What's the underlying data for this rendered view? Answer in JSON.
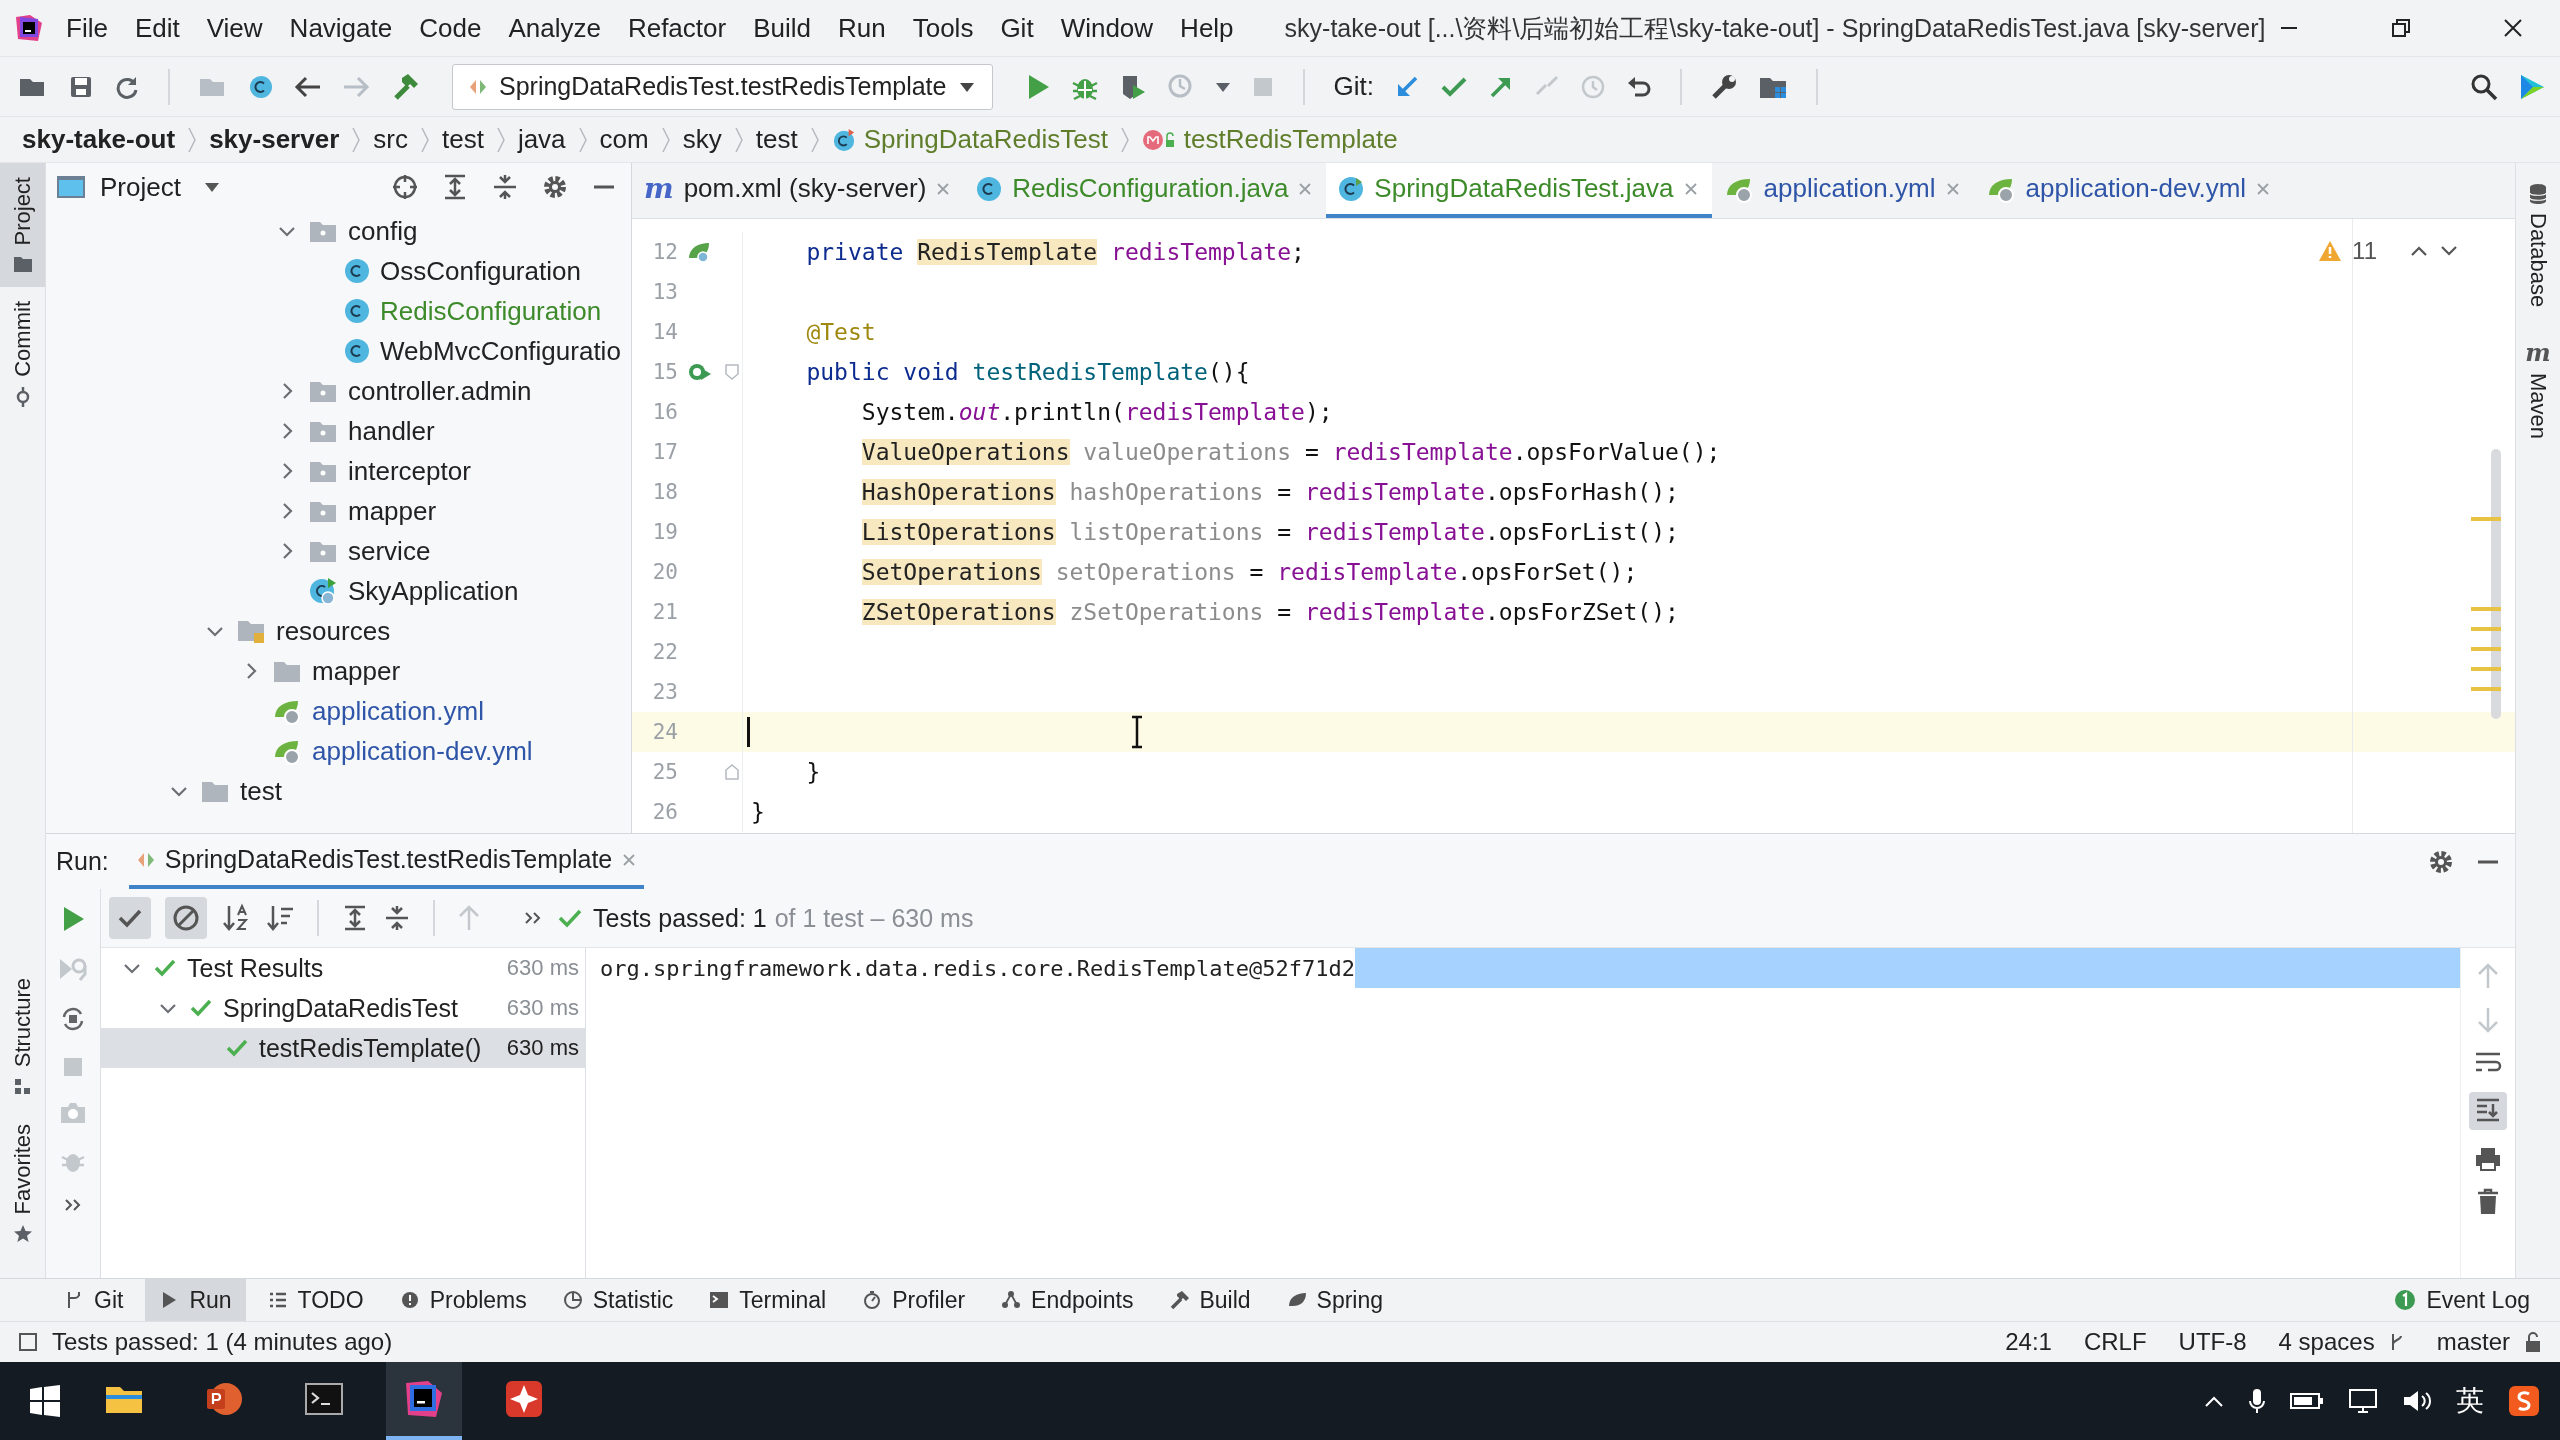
{
  "window": {
    "title": "sky-take-out [...\\资料\\后端初始工程\\sky-take-out] - SpringDataRedisTest.java [sky-server]",
    "menu": [
      "File",
      "Edit",
      "View",
      "Navigate",
      "Code",
      "Analyze",
      "Refactor",
      "Build",
      "Run",
      "Tools",
      "Git",
      "Window",
      "Help"
    ]
  },
  "toolbar": {
    "run_config": "SpringDataRedisTest.testRedisTemplate",
    "git_label": "Git:"
  },
  "breadcrumbs": [
    {
      "label": "sky-take-out",
      "kind": "module"
    },
    {
      "label": "sky-server",
      "kind": "module"
    },
    {
      "label": "src",
      "kind": "dir"
    },
    {
      "label": "test",
      "kind": "dir"
    },
    {
      "label": "java",
      "kind": "dir"
    },
    {
      "label": "com",
      "kind": "dir"
    },
    {
      "label": "sky",
      "kind": "dir"
    },
    {
      "label": "test",
      "kind": "dir"
    },
    {
      "label": "SpringDataRedisTest",
      "kind": "class"
    },
    {
      "label": "testRedisTemplate",
      "kind": "method"
    }
  ],
  "left_stripe": {
    "top": [
      {
        "label": "Project",
        "kind": "project",
        "selected": true
      },
      {
        "label": "Commit",
        "kind": "commit",
        "selected": false
      }
    ],
    "bottom": [
      {
        "label": "Structure",
        "kind": "structure",
        "selected": false
      },
      {
        "label": "Favorites",
        "kind": "favorites",
        "selected": false
      }
    ]
  },
  "right_stripe": [
    {
      "label": "Database",
      "kind": "database"
    },
    {
      "label": "Maven",
      "kind": "maven",
      "icon": "m"
    }
  ],
  "project_panel": {
    "title": "Project",
    "tree": [
      {
        "children": [
          {
            "children": [
              {
                "children": [
                  {
                    "children": [
                      {
                        "label": "config",
                        "kind": "package",
                        "expanded": true,
                        "children": [
                          {
                            "label": "OssConfiguration",
                            "kind": "class",
                            "color": "#222222"
                          },
                          {
                            "label": "RedisConfiguration",
                            "kind": "class",
                            "color": "#3d8a2a"
                          },
                          {
                            "label": "WebMvcConfiguratio",
                            "kind": "class",
                            "color": "#222222"
                          }
                        ]
                      },
                      {
                        "label": "controller.admin",
                        "kind": "package",
                        "expanded": false
                      },
                      {
                        "label": "handler",
                        "kind": "package",
                        "expanded": false
                      },
                      {
                        "label": "interceptor",
                        "kind": "package",
                        "expanded": false
                      },
                      {
                        "label": "mapper",
                        "kind": "package",
                        "expanded": false
                      },
                      {
                        "label": "service",
                        "kind": "package",
                        "expanded": false
                      },
                      {
                        "label": "SkyApplication",
                        "kind": "app",
                        "color": "#222222"
                      }
                    ]
                  }
                ]
              },
              {
                "label": "resources",
                "kind": "resources",
                "expanded": true,
                "children": [
                  {
                    "label": "mapper",
                    "kind": "folder",
                    "expanded": false
                  },
                  {
                    "label": "application.yml",
                    "kind": "yaml",
                    "color": "#2f55a8"
                  },
                  {
                    "label": "application-dev.yml",
                    "kind": "yaml",
                    "color": "#2f55a8"
                  }
                ]
              }
            ]
          },
          {
            "label": "test",
            "kind": "folder",
            "expanded": true
          }
        ]
      }
    ]
  },
  "editor": {
    "tabs": [
      {
        "label": "pom.xml (sky-server)",
        "kind": "maven",
        "icon": "m",
        "color": "#222222",
        "selected": false
      },
      {
        "label": "RedisConfiguration.java",
        "kind": "class",
        "color": "#3d8a2a",
        "selected": false
      },
      {
        "label": "SpringDataRedisTest.java",
        "kind": "test",
        "color": "#3d8a2a",
        "selected": true
      },
      {
        "label": "application.yml",
        "kind": "yaml",
        "color": "#2f55a8",
        "selected": false
      },
      {
        "label": "application-dev.yml",
        "kind": "yaml",
        "color": "#2f55a8",
        "selected": false
      }
    ],
    "warnings": "11",
    "lines": [
      {
        "number": "12",
        "gutter_icon": {
          "kind": "bean"
        },
        "current": false,
        "segments": [
          {
            "text": "    private ",
            "kind": "keyword"
          },
          {
            "text": "RedisTemplate",
            "kind": "flagged"
          },
          {
            "text": " redisTemplate",
            "kind": "field"
          },
          {
            "text": ";",
            "kind": "plain"
          }
        ]
      },
      {
        "number": "13",
        "current": false
      },
      {
        "number": "14",
        "current": false,
        "segments": [
          {
            "text": "    @Test",
            "kind": "annotation"
          }
        ]
      },
      {
        "number": "15",
        "gutter_icon": {
          "kind": "run"
        },
        "fold_marker": {
          "kind": "start"
        },
        "current": false,
        "segments": [
          {
            "text": "    public void ",
            "kind": "keyword"
          },
          {
            "text": "testRedisTemplate",
            "kind": "method"
          },
          {
            "text": "(){",
            "kind": "plain"
          }
        ]
      },
      {
        "number": "16",
        "current": false,
        "segments": [
          {
            "text": "        System.",
            "kind": "plain"
          },
          {
            "text": "out",
            "kind": "static"
          },
          {
            "text": ".println(",
            "kind": "plain"
          },
          {
            "text": "redisTemplate",
            "kind": "field"
          },
          {
            "text": ");",
            "kind": "plain"
          }
        ]
      },
      {
        "number": "17",
        "current": false,
        "segments": [
          {
            "text": "        ValueOperations",
            "kind": "flagged"
          },
          {
            "text": " valueOperations",
            "kind": "unused"
          },
          {
            "text": " = ",
            "kind": "plain"
          },
          {
            "text": "redisTemplate",
            "kind": "field"
          },
          {
            "text": ".opsForValue();",
            "kind": "plain"
          }
        ]
      },
      {
        "number": "18",
        "current": false,
        "segments": [
          {
            "text": "        HashOperations",
            "kind": "flagged"
          },
          {
            "text": " hashOperations",
            "kind": "unused"
          },
          {
            "text": " = ",
            "kind": "plain"
          },
          {
            "text": "redisTemplate",
            "kind": "field"
          },
          {
            "text": ".opsForHash();",
            "kind": "plain"
          }
        ]
      },
      {
        "number": "19",
        "current": false,
        "segments": [
          {
            "text": "        ListOperations",
            "kind": "flagged"
          },
          {
            "text": " listOperations",
            "kind": "unused"
          },
          {
            "text": " = ",
            "kind": "plain"
          },
          {
            "text": "redisTemplate",
            "kind": "field"
          },
          {
            "text": ".opsForList();",
            "kind": "plain"
          }
        ]
      },
      {
        "number": "20",
        "current": false,
        "segments": [
          {
            "text": "        SetOperations",
            "kind": "flagged"
          },
          {
            "text": " setOperations",
            "kind": "unused"
          },
          {
            "text": " = ",
            "kind": "plain"
          },
          {
            "text": "redisTemplate",
            "kind": "field"
          },
          {
            "text": ".opsForSet();",
            "kind": "plain"
          }
        ]
      },
      {
        "number": "21",
        "current": false,
        "segments": [
          {
            "text": "        ZSetOperations",
            "kind": "flagged"
          },
          {
            "text": " zSetOperations",
            "kind": "unused"
          },
          {
            "text": " = ",
            "kind": "plain"
          },
          {
            "text": "redisTemplate",
            "kind": "field"
          },
          {
            "text": ".opsForZSet();",
            "kind": "plain"
          }
        ]
      },
      {
        "number": "22",
        "current": false
      },
      {
        "number": "23",
        "current": false
      },
      {
        "number": "24",
        "current": true
      },
      {
        "number": "25",
        "fold_marker": {
          "kind": "end"
        },
        "current": false,
        "segments": [
          {
            "text": "    }",
            "kind": "plain"
          }
        ]
      },
      {
        "number": "26",
        "current": false,
        "segments": [
          {
            "text": "}",
            "kind": "plain"
          }
        ]
      }
    ]
  },
  "run_panel": {
    "label": "Run:",
    "tab": "SpringDataRedisTest.testRedisTemplate",
    "status": "Tests passed: 1",
    "status_detail": "of 1 test – 630 ms",
    "results": [
      {
        "label": "Test Results",
        "duration": "630 ms",
        "passed": true,
        "expanded": true,
        "selected": false,
        "children": [
          {
            "label": "SpringDataRedisTest",
            "duration": "630 ms",
            "passed": true,
            "expanded": true,
            "selected": false,
            "children": [
              {
                "label": "testRedisTemplate()",
                "duration": "630 ms",
                "passed": true,
                "selected": true
              }
            ]
          }
        ]
      }
    ],
    "console": [
      {
        "text": "org.springframework.data.redis.core.RedisTemplate@52f71d2",
        "selected": true
      }
    ]
  },
  "tool_windows": [
    {
      "label": "Git",
      "kind": "git",
      "selected": false
    },
    {
      "label": "Run",
      "kind": "run",
      "selected": true
    },
    {
      "label": "TODO",
      "kind": "todo",
      "selected": false
    },
    {
      "label": "Problems",
      "kind": "problems",
      "selected": false
    },
    {
      "label": "Statistic",
      "kind": "statistic",
      "selected": false
    },
    {
      "label": "Terminal",
      "kind": "terminal",
      "selected": false
    },
    {
      "label": "Profiler",
      "kind": "profiler",
      "selected": false
    },
    {
      "label": "Endpoints",
      "kind": "endpoints",
      "selected": false
    },
    {
      "label": "Build",
      "kind": "build",
      "selected": false
    },
    {
      "label": "Spring",
      "kind": "spring",
      "selected": false
    }
  ],
  "event_log": "Event Log",
  "status_bar": {
    "message": "Tests passed: 1 (4 minutes ago)",
    "position": "24:1",
    "line_separator": "CRLF",
    "encoding": "UTF-8",
    "indent": "4 spaces",
    "branch": "master"
  },
  "taskbar": {
    "apps": [
      {
        "kind": "explorer",
        "selected": false
      },
      {
        "kind": "slides",
        "selected": false
      },
      {
        "kind": "console",
        "selected": false
      },
      {
        "kind": "ide",
        "selected": true
      },
      {
        "kind": "tool",
        "selected": false
      }
    ],
    "ime": "英"
  }
}
